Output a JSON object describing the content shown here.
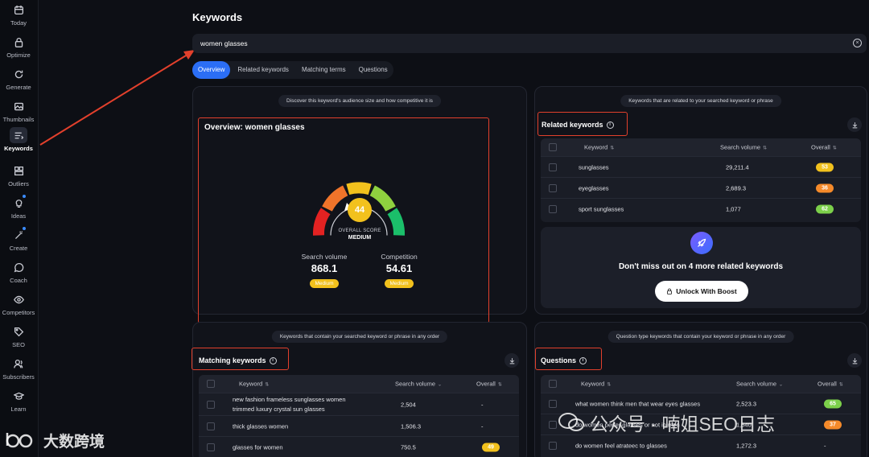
{
  "sidebar": {
    "items": [
      {
        "label": "Today",
        "icon": "calendar-icon"
      },
      {
        "label": "Optimize",
        "icon": "lock-icon"
      },
      {
        "label": "Generate",
        "icon": "refresh-icon"
      },
      {
        "label": "Thumbnails",
        "icon": "image-icon"
      },
      {
        "label": "Keywords",
        "icon": "keywords-icon"
      },
      {
        "label": "Outliers",
        "icon": "grid-icon"
      },
      {
        "label": "Ideas",
        "icon": "lightbulb-icon"
      },
      {
        "label": "Create",
        "icon": "wand-icon"
      },
      {
        "label": "Coach",
        "icon": "chat-icon"
      },
      {
        "label": "Competitors",
        "icon": "eye-icon"
      },
      {
        "label": "SEO",
        "icon": "tag-icon"
      },
      {
        "label": "Subscribers",
        "icon": "users-icon"
      },
      {
        "label": "Learn",
        "icon": "graduation-cap-icon"
      }
    ]
  },
  "page": {
    "title": "Keywords"
  },
  "search": {
    "value": "women glasses"
  },
  "tabs": [
    "Overview",
    "Related keywords",
    "Matching terms",
    "Questions"
  ],
  "overview": {
    "pill": "Discover this keyword's audience size and how competitive it is",
    "title": "Overview: women glasses",
    "score": "44",
    "score_label": "OVERALL SCORE",
    "score_level": "MEDIUM",
    "search_volume_label": "Search volume",
    "search_volume": "868.1",
    "search_volume_badge": "Medium",
    "competition_label": "Competition",
    "competition": "54.61",
    "competition_badge": "Medium"
  },
  "related": {
    "pill": "Keywords that are related to your searched keyword or phrase",
    "title": "Related keywords",
    "headers": [
      "Keyword",
      "Search volume",
      "Overall"
    ],
    "rows": [
      {
        "keyword": "sunglasses",
        "volume": "29,211.4",
        "overall": "53",
        "color": "#f2c11d"
      },
      {
        "keyword": "eyeglasses",
        "volume": "2,689.3",
        "overall": "36",
        "color": "#f58a2a"
      },
      {
        "keyword": "sport sunglasses",
        "volume": "1,077",
        "overall": "62",
        "color": "#7cd04a"
      }
    ],
    "boost_text": "Don't miss out on 4 more related keywords",
    "boost_button": "Unlock With Boost"
  },
  "matching": {
    "pill": "Keywords that contain your searched keyword or phrase in any order",
    "title": "Matching keywords",
    "headers": [
      "Keyword",
      "Search volume",
      "Overall"
    ],
    "rows": [
      {
        "keyword_line1": "new fashion frameless sunglasses women",
        "keyword_line2": "trimmed luxury crystal sun glasses",
        "volume": "2,504",
        "overall": "-"
      },
      {
        "keyword_line1": "thick glasses women",
        "keyword_line2": "",
        "volume": "1,506.3",
        "overall": "-"
      },
      {
        "keyword_line1": "glasses for women",
        "keyword_line2": "",
        "volume": "750.5",
        "overall": "49",
        "color": "#f2c11d"
      }
    ]
  },
  "questions": {
    "pill": "Question type keywords that contain your keyword or phrase in any order",
    "title": "Questions",
    "headers": [
      "Keyword",
      "Search volume",
      "Overall"
    ],
    "rows": [
      {
        "keyword": "what women think men that wear eyes glasses",
        "volume": "2,523.3",
        "overall": "65",
        "color": "#7cd04a"
      },
      {
        "keyword": "do women perfer glasses or not in men",
        "volume": "1,540",
        "overall": "37",
        "color": "#f58a2a"
      },
      {
        "keyword": "do women feel atrateec to glasses",
        "volume": "1,272.3",
        "overall": "-"
      }
    ]
  },
  "watermarks": {
    "left": "大数跨境",
    "right": "公众号 · 喃姐SEO日志"
  },
  "colors": {
    "accent": "#2b6ef5",
    "annotation": "#e2402c",
    "medium": "#f2c11d"
  }
}
